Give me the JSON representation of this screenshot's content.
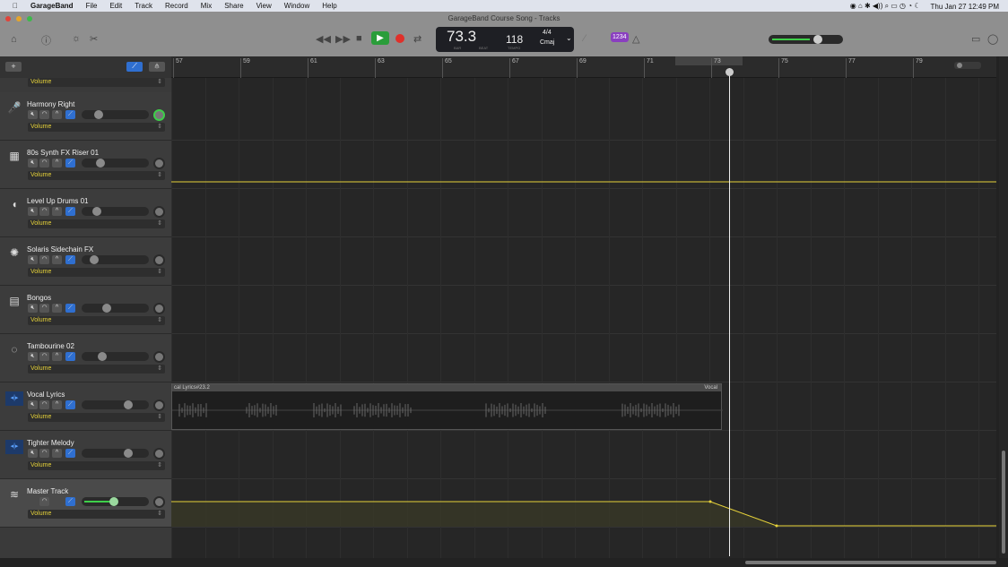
{
  "menubar": {
    "app": "GarageBand",
    "items": [
      "File",
      "Edit",
      "Track",
      "Record",
      "Mix",
      "Share",
      "View",
      "Window",
      "Help"
    ],
    "clock": "Thu Jan 27  12:49 PM"
  },
  "window": {
    "title": "GarageBand Course Song - Tracks"
  },
  "lcd": {
    "bar_beat": "73.3",
    "bar_label": "BAR",
    "beat_label": "BEAT",
    "tempo": "118",
    "tempo_label": "TEMPO",
    "time_sig": "4/4",
    "key": "Cmaj"
  },
  "toolbar": {
    "count_in": "1234"
  },
  "master_volume": 0.7,
  "ruler": {
    "bars": [
      "57",
      "59",
      "61",
      "63",
      "65",
      "67",
      "69",
      "71",
      "73",
      "75",
      "77",
      "79"
    ]
  },
  "colors": {
    "automation": "#e6d23a",
    "play": "#2a9d3a",
    "record": "#e0302a",
    "blue": "#2f6fd0"
  },
  "header": {
    "add_label": "+",
    "top_volume": "Volume"
  },
  "tracks": [
    {
      "name": "Harmony Right",
      "icon": "microphone-icon",
      "volume_label": "Volume",
      "level": 0.22
    },
    {
      "name": "80s Synth FX Riser 01",
      "icon": "synth-icon",
      "volume_label": "Volume",
      "level": 0.24
    },
    {
      "name": "Level Up Drums 01",
      "icon": "drum-icon",
      "volume_label": "Volume",
      "level": 0.18
    },
    {
      "name": "Solaris Sidechain FX",
      "icon": "sparkle-icon",
      "volume_label": "Volume",
      "level": 0.14
    },
    {
      "name": "Bongos",
      "icon": "drum-machine-icon",
      "volume_label": "Volume",
      "level": 0.35
    },
    {
      "name": "Tambourine 02",
      "icon": "tambourine-icon",
      "volume_label": "Volume",
      "level": 0.28
    },
    {
      "name": "Vocal Lyrics",
      "icon": "audio-waveform-icon",
      "volume_label": "Volume",
      "level": 0.72
    },
    {
      "name": "Tighter Melody",
      "icon": "audio-waveform-icon",
      "volume_label": "Volume",
      "level": 0.72
    },
    {
      "name": "Master Track",
      "icon": "master-icon",
      "volume_label": "Volume",
      "level": 0.48
    }
  ],
  "region": {
    "name": "cal Lyrics#23.2",
    "name_right": "Vocal"
  }
}
